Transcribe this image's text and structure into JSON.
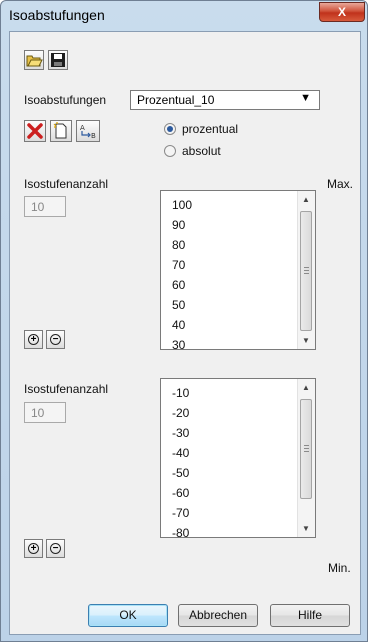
{
  "window": {
    "title": "Isoabstufungen",
    "close_glyph": "X"
  },
  "toolbar": {
    "open_icon": "folder-open-icon",
    "save_icon": "floppy-save-icon"
  },
  "preset": {
    "label": "Isoabstufungen",
    "selected": "Prozentual_10",
    "arrow": "▼"
  },
  "actions": {
    "delete_icon": "red-x-delete-icon",
    "new_icon": "new-document-icon",
    "rename_icon": "rename-ab-icon"
  },
  "mode": {
    "option1": "prozentual",
    "option2": "absolut",
    "selected": "prozentual"
  },
  "max_section": {
    "count_label": "Isostufenanzahl",
    "count_value": "10",
    "max_label": "Max.",
    "items": [
      "100",
      "90",
      "80",
      "70",
      "60",
      "50",
      "40",
      "30"
    ],
    "scroll_up": "▲",
    "scroll_down": "▼",
    "add_glyph": "+",
    "remove_glyph": "−"
  },
  "min_section": {
    "count_label": "Isostufenanzahl",
    "count_value": "10",
    "min_label": "Min.",
    "items": [
      "-10",
      "-20",
      "-30",
      "-40",
      "-50",
      "-60",
      "-70",
      "-80"
    ],
    "scroll_up": "▲",
    "scroll_down": "▼",
    "add_glyph": "+",
    "remove_glyph": "−"
  },
  "buttons": {
    "ok": "OK",
    "cancel": "Abbrechen",
    "help": "Hilfe"
  },
  "colors": {
    "accent": "#2c5a9e",
    "delete": "#cc1f1f",
    "close": "#c0321c"
  }
}
